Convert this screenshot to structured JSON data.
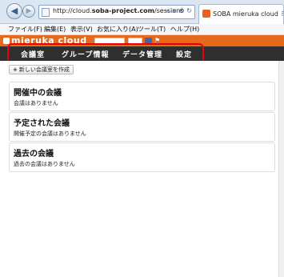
{
  "browser": {
    "url_prefix": "http://cloud.",
    "url_host": "soba-project.com",
    "url_path": "/sessions",
    "addr_controls": "→ × ⚙ ↻",
    "tab_title": "SOBA mieruka cloud ミ"
  },
  "menubar": {
    "items": [
      "ファイル(F)",
      "編集(E)",
      "表示(V)",
      "お気に入り(A)",
      "ツール(T)",
      "ヘルプ(H)"
    ]
  },
  "brand": {
    "logo": "mieruka cloud"
  },
  "nav": {
    "items": [
      "会議室",
      "グループ情報",
      "データ管理",
      "設定"
    ]
  },
  "content": {
    "create_button": "新しい会議室を作成",
    "sections": [
      {
        "title": "開催中の会議",
        "note": "会議はありません"
      },
      {
        "title": "予定された会議",
        "note": "開催予定の会議はありません"
      },
      {
        "title": "過去の会議",
        "note": "過去の会議はありません"
      }
    ]
  },
  "icons": {
    "back": "back-arrow-icon",
    "forward": "forward-arrow-icon",
    "page": "page-icon",
    "favicon": "soba-favicon-icon"
  },
  "colors": {
    "brand_orange": "#e56a1b",
    "nav_dark": "#2f2f2f",
    "highlight_red": "#e60012"
  }
}
